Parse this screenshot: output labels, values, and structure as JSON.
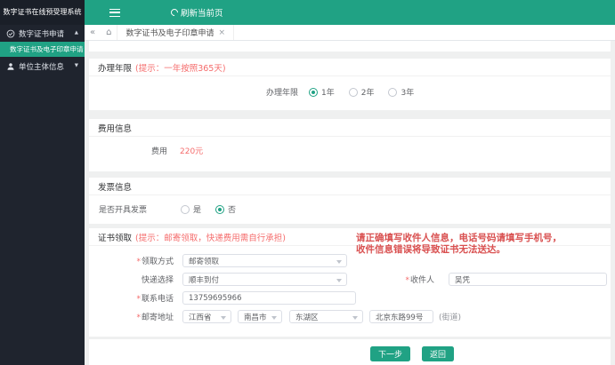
{
  "sidebar": {
    "title": "数字证书在线预受理系统",
    "menu": [
      {
        "label": "数字证书申请",
        "icon": "certificate-check-icon",
        "state": "expanded"
      },
      {
        "label": "数字证书及电子印章申请",
        "active": true
      },
      {
        "label": "单位主体信息",
        "icon": "organization-icon",
        "state": "collapsed"
      }
    ]
  },
  "topbar": {
    "refresh_label": "刷新当前页"
  },
  "tabbar": {
    "tabs": [
      {
        "label": "数字证书及电子印章申请",
        "active": true,
        "closable": true
      }
    ]
  },
  "icons": {
    "back": "«",
    "home": "⌂",
    "close": "×",
    "caret_up": "▲",
    "caret_down": "▼"
  },
  "sections": {
    "years": {
      "title": "办理年限",
      "hint": "(提示：一年按照365天)",
      "row_label": "办理年限",
      "options": [
        {
          "label": "1年",
          "selected": true
        },
        {
          "label": "2年",
          "selected": false
        },
        {
          "label": "3年",
          "selected": false
        }
      ]
    },
    "fee": {
      "title": "费用信息",
      "row_label": "费用",
      "value": "220元"
    },
    "invoice": {
      "title": "发票信息",
      "row_label": "是否开具发票",
      "options": [
        {
          "label": "是",
          "selected": false
        },
        {
          "label": "否",
          "selected": true
        }
      ]
    },
    "delivery": {
      "title": "证书领取",
      "hint": "(提示：邮寄领取，快递费用需自行承担)",
      "warning_line1": "请正确填写收件人信息，电话号码请填写手机号，",
      "warning_line2": "收件信息错误将导致证书无法送达。",
      "fields": {
        "method": {
          "req": "*",
          "label": "领取方式",
          "value": "邮寄领取"
        },
        "express": {
          "req": "",
          "label": "快递选择",
          "value": "顺丰到付"
        },
        "phone": {
          "req": "*",
          "label": "联系电话",
          "value": "13759695966"
        },
        "address": {
          "req": "*",
          "label": "邮寄地址",
          "province": "江西省",
          "city": "南昌市",
          "district": "东湖区",
          "street": "北京东路99号",
          "street_hint": "(街道)"
        },
        "recipient": {
          "req": "*",
          "label": "收件人",
          "value": "吴凭"
        }
      }
    }
  },
  "footer": {
    "next_label": "下一步",
    "back_label": "返回"
  },
  "colors": {
    "accent": "#20a284",
    "sidebar_bg": "#1f242e",
    "content_bg": "#eff0f0",
    "danger": "#f56c6c",
    "warning_text": "#d95050"
  }
}
